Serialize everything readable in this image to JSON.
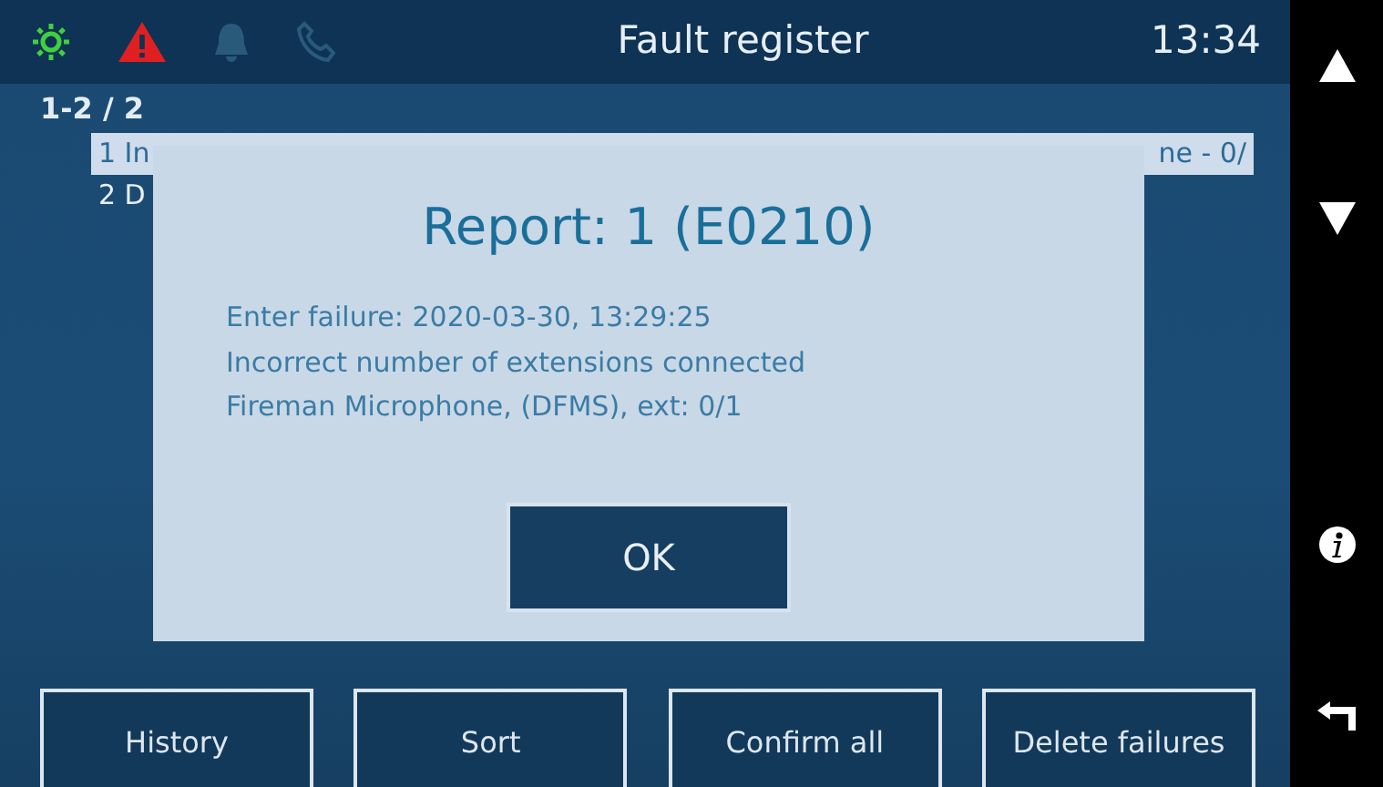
{
  "status_bar": {
    "icons": [
      {
        "kind": "sun",
        "active": true
      },
      {
        "kind": "warning",
        "active": true
      },
      {
        "kind": "bell",
        "active": false
      },
      {
        "kind": "phone",
        "active": false
      }
    ],
    "title": "Fault register",
    "time": "13:34"
  },
  "list": {
    "range": "1-2 / 2",
    "rows": [
      {
        "start": "1 In",
        "end": "ne - 0/",
        "selected": true
      },
      {
        "start": "2 D",
        "end": "",
        "selected": false
      }
    ]
  },
  "dialog": {
    "title": "Report: 1 (E0210)",
    "lines": [
      "Enter failure: 2020-03-30, 13:29:25",
      "Incorrect number of extensions connected",
      "Fireman Microphone, (DFMS), ext: 0/1"
    ],
    "button": "OK"
  },
  "buttons": [
    {
      "label": "History"
    },
    {
      "label": "Sort"
    },
    {
      "label": "Confirm all"
    },
    {
      "label": "Delete failures"
    }
  ],
  "side_keys": [
    {
      "kind": "up"
    },
    {
      "kind": "down"
    },
    {
      "kind": "info"
    },
    {
      "kind": "back"
    }
  ]
}
